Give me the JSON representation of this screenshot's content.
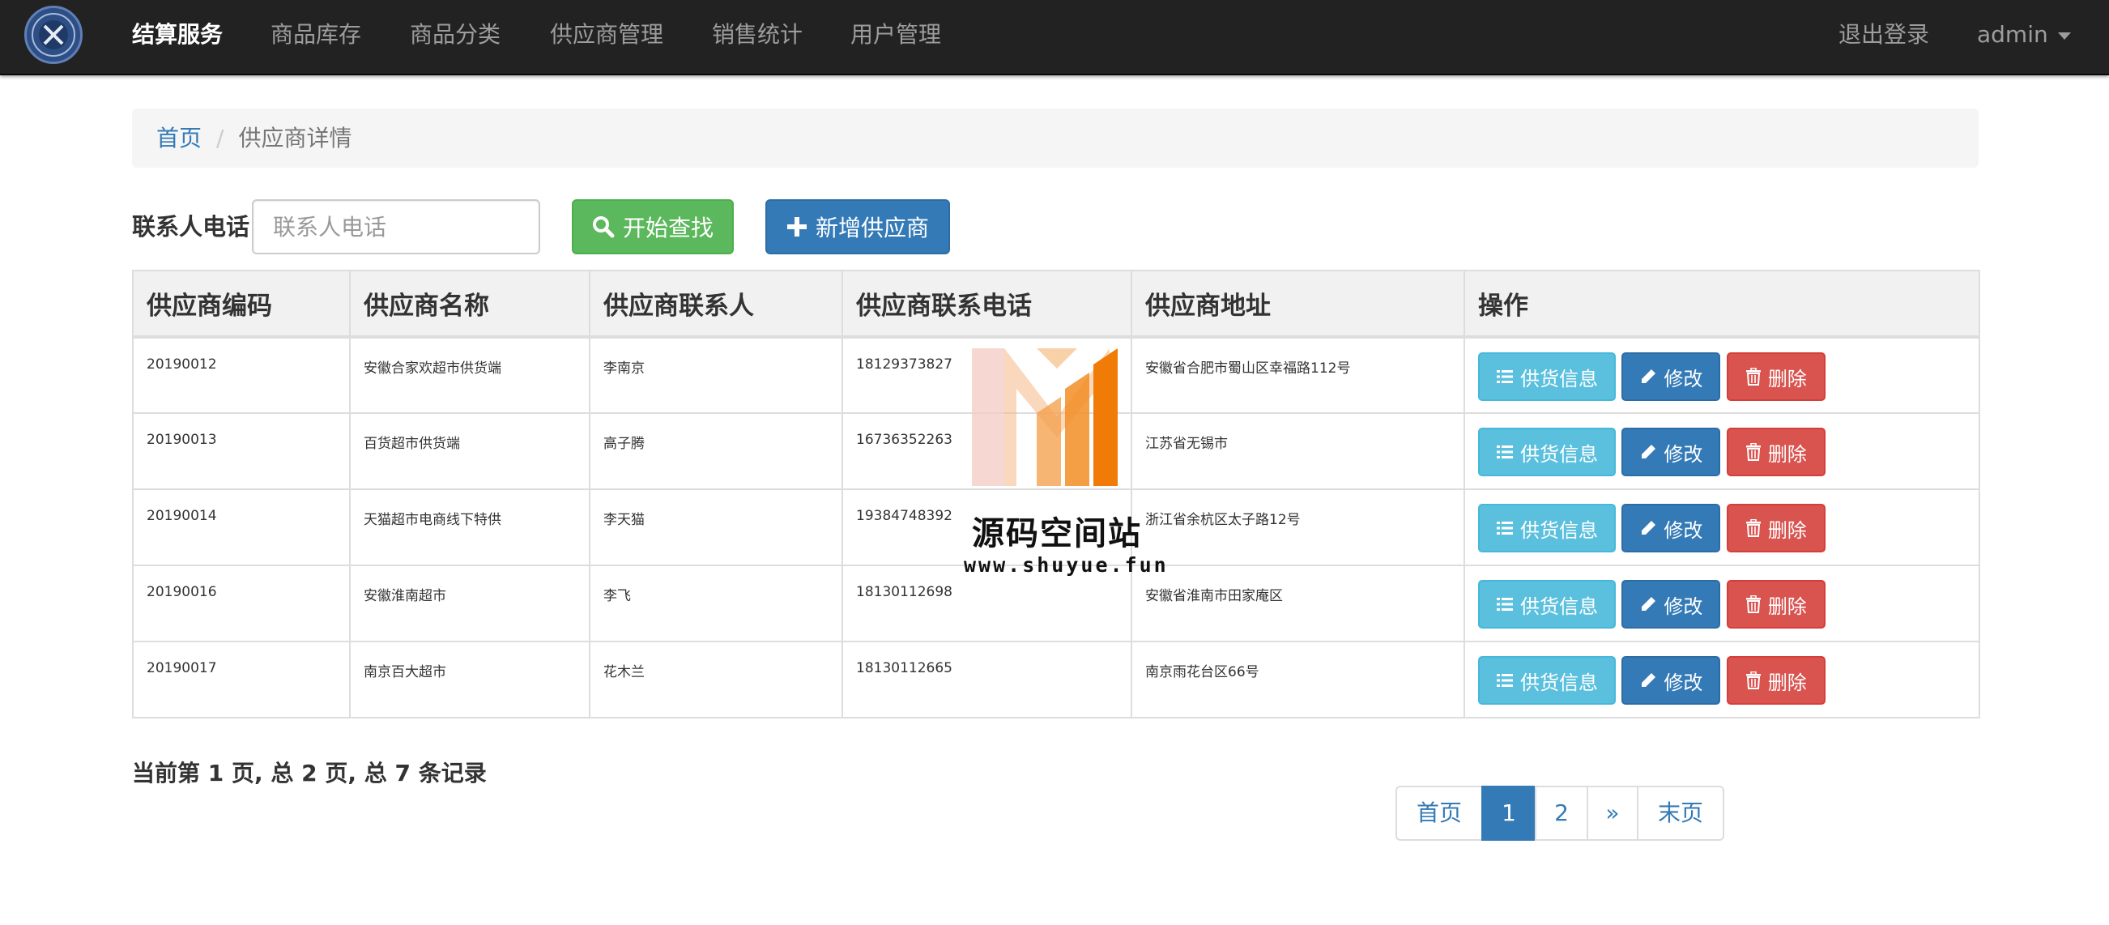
{
  "navbar": {
    "brand": "结算服务",
    "items": [
      "商品库存",
      "商品分类",
      "供应商管理",
      "销售统计",
      "用户管理"
    ],
    "logout": "退出登录",
    "user": "admin"
  },
  "breadcrumb": {
    "home": "首页",
    "separator": "/",
    "current": "供应商详情"
  },
  "search": {
    "label": "联系人电话",
    "placeholder": "联系人电话",
    "value": "",
    "search_button": "开始查找",
    "add_button": "新增供应商"
  },
  "table": {
    "headers": [
      "供应商编码",
      "供应商名称",
      "供应商联系人",
      "供应商联系电话",
      "供应商地址",
      "操作"
    ],
    "rows": [
      {
        "code": "20190012",
        "name": "安徽合家欢超市供货端",
        "contact": "李南京",
        "phone": "18129373827",
        "address": "安徽省合肥市蜀山区幸福路112号"
      },
      {
        "code": "20190013",
        "name": "百货超市供货端",
        "contact": "高子腾",
        "phone": "16736352263",
        "address": "江苏省无锡市"
      },
      {
        "code": "20190014",
        "name": "天猫超市电商线下特供",
        "contact": "李天猫",
        "phone": "19384748392",
        "address": "浙江省余杭区太子路12号"
      },
      {
        "code": "20190016",
        "name": "安徽淮南超市",
        "contact": "李飞",
        "phone": "18130112698",
        "address": "安徽省淮南市田家庵区"
      },
      {
        "code": "20190017",
        "name": "南京百大超市",
        "contact": "花木兰",
        "phone": "18130112665",
        "address": "南京雨花台区66号"
      }
    ],
    "actions": {
      "info": "供货信息",
      "edit": "修改",
      "delete": "删除"
    }
  },
  "watermark": {
    "title": "源码空间站",
    "url": "www.shuyue.fun"
  },
  "footer": {
    "page_info": "当前第 1 页, 总 2 页, 总 7 条记录",
    "pagination": [
      "首页",
      "1",
      "2",
      "»",
      "末页"
    ],
    "active_page": "1"
  },
  "colors": {
    "navbar": "#222222",
    "link": "#337ab7",
    "success": "#5cb85c",
    "info": "#5bc0de",
    "danger": "#d9534f"
  },
  "icons": {
    "search_button": "search-icon",
    "add_button": "plus-icon",
    "info": "list-icon",
    "edit": "pencil-icon",
    "delete": "trash-icon",
    "user_menu": "caret-down-icon"
  }
}
